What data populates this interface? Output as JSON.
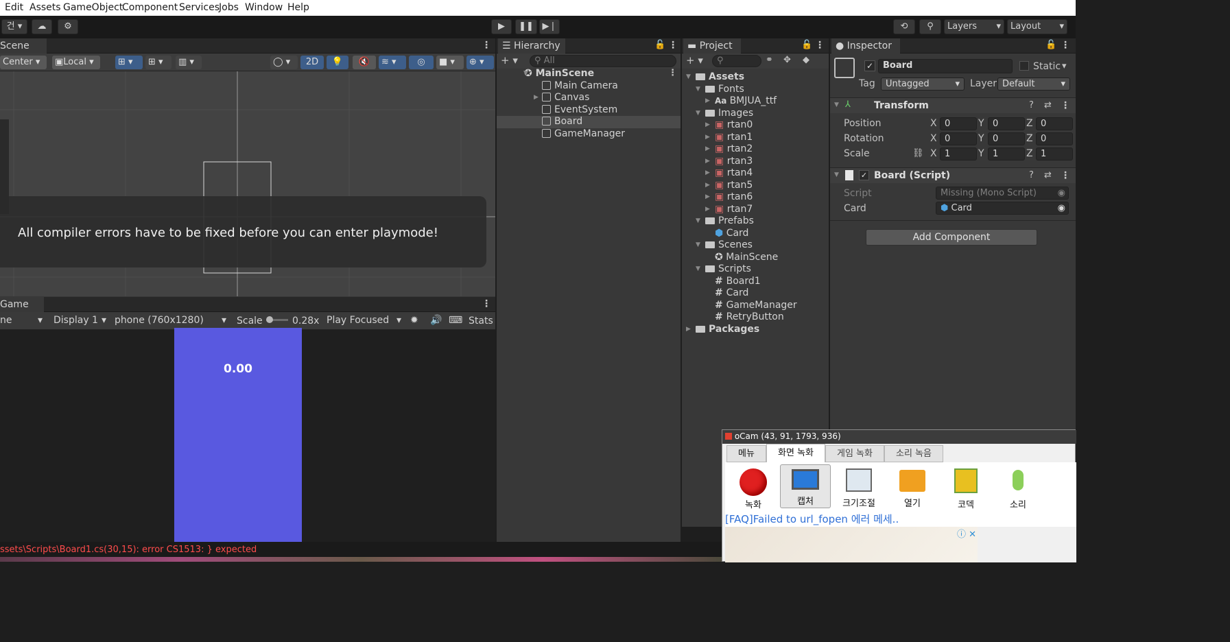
{
  "menubar": {
    "items": [
      "Edit",
      "Assets",
      "GameObject",
      "Component",
      "Services",
      "Jobs",
      "Window",
      "Help"
    ]
  },
  "toolbar": {
    "account": "건",
    "layers": "Layers",
    "layout": "Layout"
  },
  "scene": {
    "tab": "Scene",
    "center": "Center",
    "local": "Local",
    "btn2d": "2D",
    "playmode_error": "All compiler errors have to be fixed before you can enter playmode!"
  },
  "game": {
    "tab": "Game",
    "view": "ne",
    "display": "Display 1",
    "resolution": "phone (760x1280)",
    "scale_label": "Scale",
    "scale_value": "0.28x",
    "play_focused": "Play Focused",
    "stats": "Stats",
    "timer_text": "0.00",
    "game_color": "#5959e0"
  },
  "hierarchy": {
    "tab": "Hierarchy",
    "search_placeholder": "All",
    "scene": "MainScene",
    "items": [
      "Main Camera",
      "Canvas",
      "EventSystem",
      "Board",
      "GameManager"
    ]
  },
  "project": {
    "tab": "Project",
    "tree": [
      {
        "label": "Assets",
        "kind": "folder"
      },
      {
        "label": "Fonts",
        "kind": "folder"
      },
      {
        "label": "BMJUA_ttf",
        "kind": "font"
      },
      {
        "label": "Images",
        "kind": "folder"
      },
      {
        "label": "rtan0",
        "kind": "sprite"
      },
      {
        "label": "rtan1",
        "kind": "sprite"
      },
      {
        "label": "rtan2",
        "kind": "sprite"
      },
      {
        "label": "rtan3",
        "kind": "sprite"
      },
      {
        "label": "rtan4",
        "kind": "sprite"
      },
      {
        "label": "rtan5",
        "kind": "sprite"
      },
      {
        "label": "rtan6",
        "kind": "sprite"
      },
      {
        "label": "rtan7",
        "kind": "sprite"
      },
      {
        "label": "Prefabs",
        "kind": "folder"
      },
      {
        "label": "Card",
        "kind": "prefab"
      },
      {
        "label": "Scenes",
        "kind": "folder"
      },
      {
        "label": "MainScene",
        "kind": "scene"
      },
      {
        "label": "Scripts",
        "kind": "folder"
      },
      {
        "label": "Board1",
        "kind": "script"
      },
      {
        "label": "Card",
        "kind": "script"
      },
      {
        "label": "GameManager",
        "kind": "script"
      },
      {
        "label": "RetryButton",
        "kind": "script"
      },
      {
        "label": "Packages",
        "kind": "folder"
      }
    ]
  },
  "inspector": {
    "tab": "Inspector",
    "object_name": "Board",
    "static": "Static",
    "tag_label": "Tag",
    "tag": "Untagged",
    "layer_label": "Layer",
    "layer": "Default",
    "transform": {
      "title": "Transform",
      "position_label": "Position",
      "rotation_label": "Rotation",
      "scale_label": "Scale",
      "x": "X",
      "y": "Y",
      "z": "Z",
      "position": [
        "0",
        "0",
        "0"
      ],
      "rotation": [
        "0",
        "0",
        "0"
      ],
      "scale": [
        "1",
        "1",
        "1"
      ]
    },
    "script_component": {
      "title": "Board (Script)",
      "script_label": "Script",
      "script_value": "Missing (Mono Script)",
      "card_label": "Card",
      "card_value": "Card"
    },
    "add_component": "Add Component"
  },
  "console": {
    "error": "ssets\\Scripts\\Board1.cs(30,15): error CS1513: } expected"
  },
  "ocam": {
    "title": "oCam (43, 91, 1793, 936)",
    "tabs": [
      "메뉴",
      "화면 녹화",
      "게임 녹화",
      "소리 녹음"
    ],
    "tools": [
      "녹화",
      "캡처",
      "크기조절",
      "열기",
      "코덱",
      "소리"
    ],
    "faq": "[FAQ]Failed to url_fopen 에러 메세.."
  }
}
